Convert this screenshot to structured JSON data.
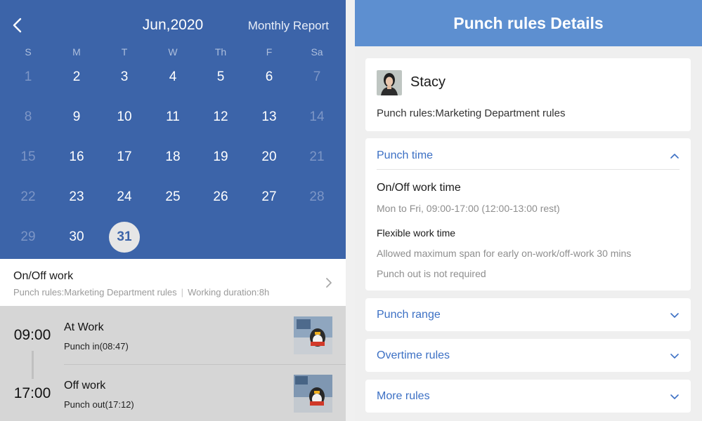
{
  "calendar": {
    "month_title": "Jun,2020",
    "monthly_report": "Monthly Report",
    "weekdays": [
      "S",
      "M",
      "T",
      "W",
      "Th",
      "F",
      "Sa"
    ],
    "weeks": [
      [
        1,
        2,
        3,
        4,
        5,
        6,
        7
      ],
      [
        8,
        9,
        10,
        11,
        12,
        13,
        14
      ],
      [
        15,
        16,
        17,
        18,
        19,
        20,
        21
      ],
      [
        22,
        23,
        24,
        25,
        26,
        27,
        28
      ],
      [
        29,
        30,
        31
      ]
    ],
    "selected_day": 31,
    "colors": {
      "header_bg": "#3c64a9",
      "dim_day": "#7d96c6"
    }
  },
  "onoff": {
    "title": "On/Off work",
    "rules": "Punch rules:Marketing Department rules",
    "separator": "|",
    "duration": "Working duration:8h"
  },
  "records": [
    {
      "time": "09:00",
      "title": "At Work",
      "sub": "Punch in(08:47)"
    },
    {
      "time": "17:00",
      "title": "Off work",
      "sub": "Punch out(17:12)"
    }
  ],
  "details": {
    "header": "Punch rules Details",
    "name": "Stacy",
    "rules": "Punch rules:Marketing Department rules",
    "punch_time": {
      "title": "Punch time",
      "onoff_title": "On/Off work time",
      "onoff_value": "Mon to Fri, 09:00-17:00 (12:00-13:00 rest)",
      "flex_title": "Flexible work time",
      "flex_value": "Allowed maximum span for early on-work/off-work 30 mins",
      "punch_out": "Punch out is not required"
    },
    "punch_range": "Punch range",
    "overtime_rules": "Overtime rules",
    "more_rules": "More rules",
    "colors": {
      "header_bg": "#5d8fd0",
      "accent": "#3c70c4"
    }
  }
}
